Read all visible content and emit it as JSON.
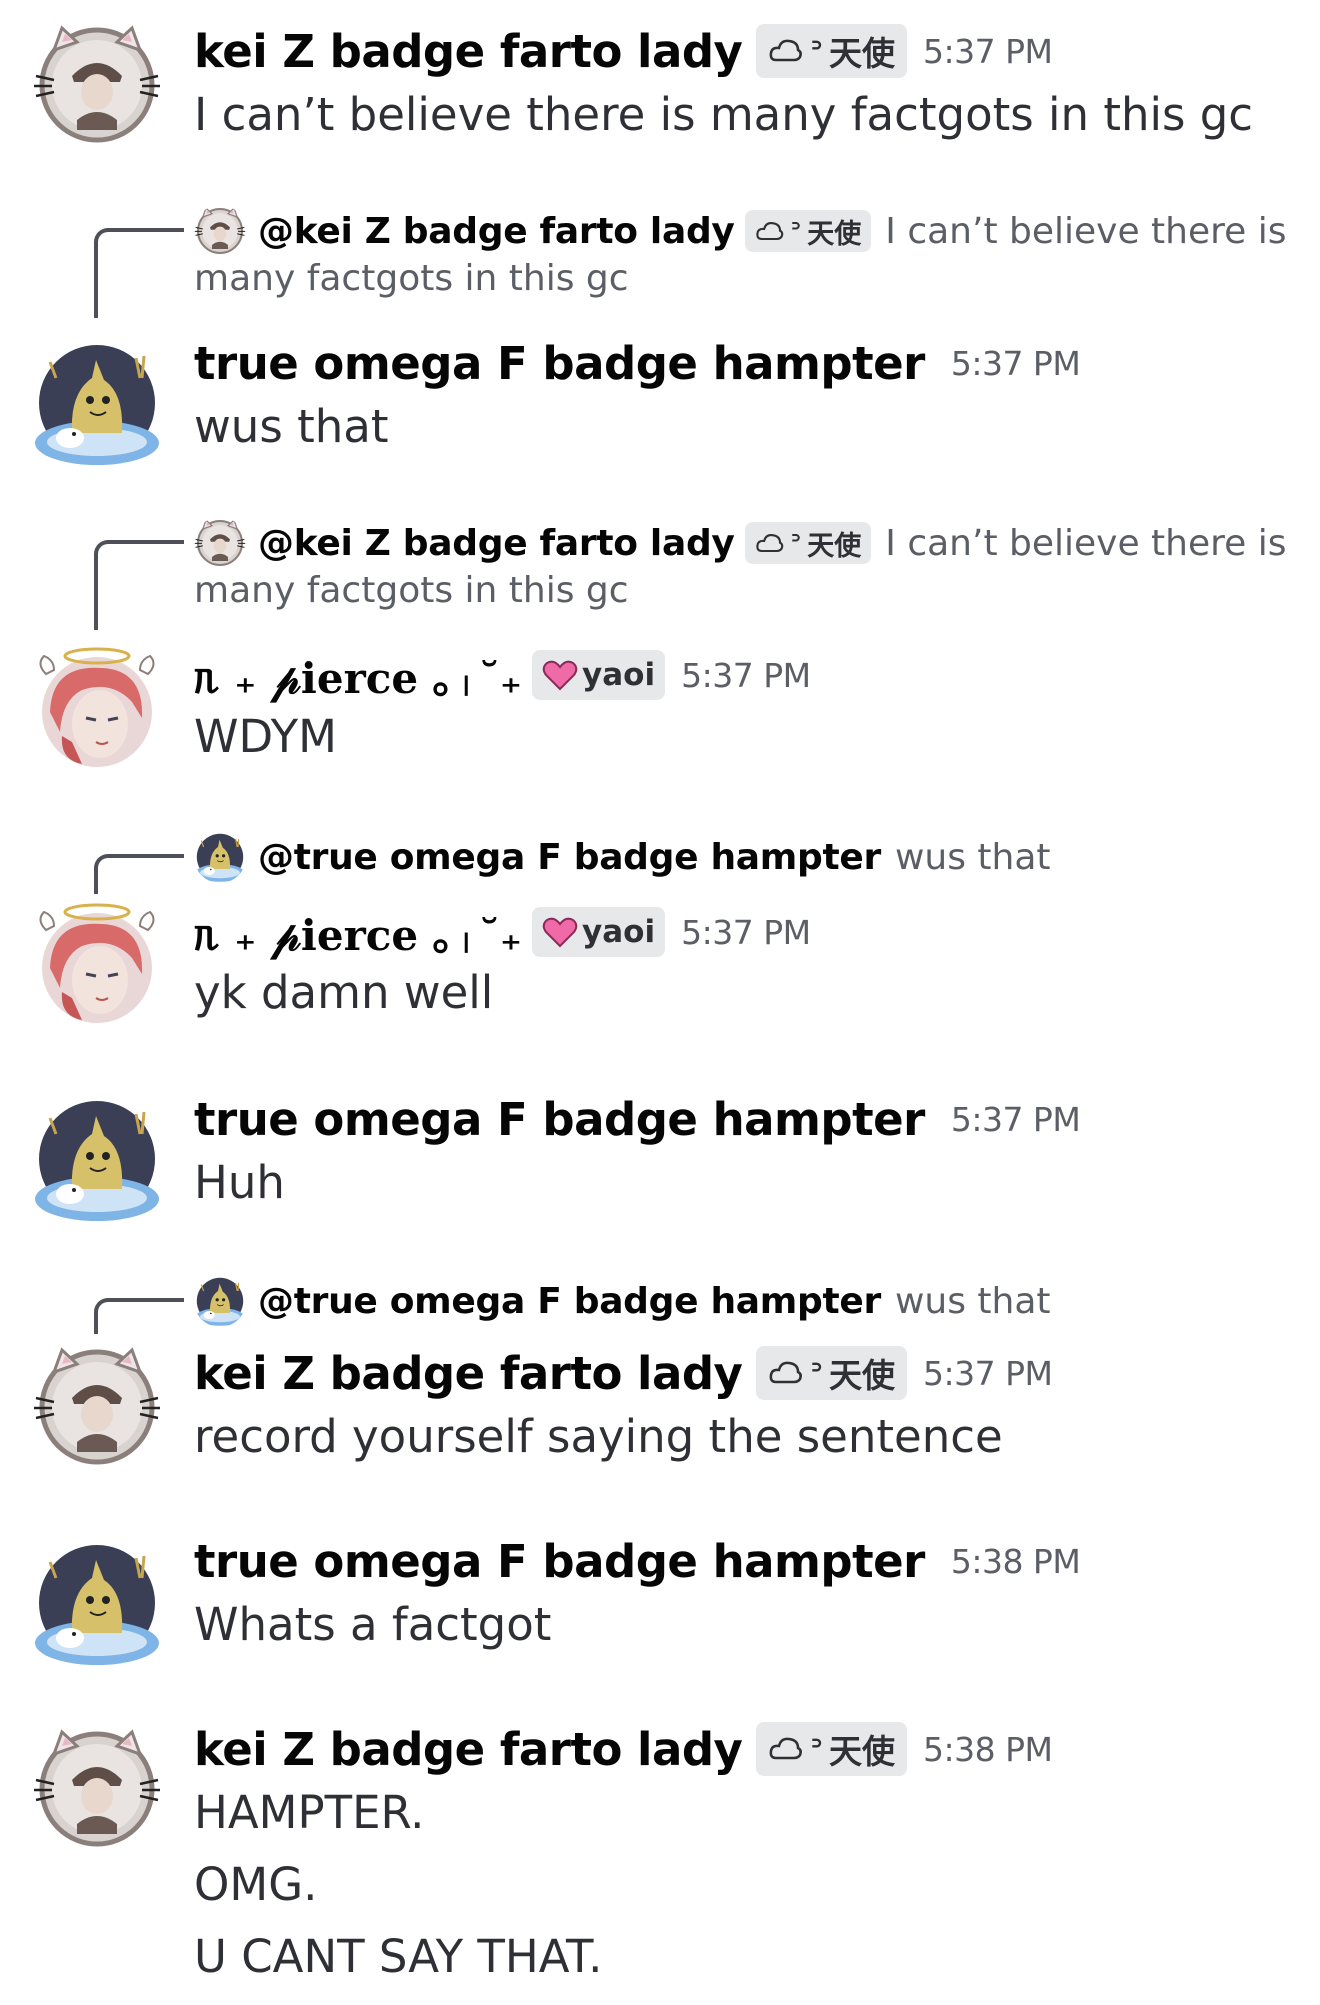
{
  "users": {
    "kei": {
      "name": "kei Z badge farto lady",
      "tag_symbol": "ᐣ",
      "tag_text": "天使"
    },
    "hampter": {
      "name": "true omega F badge hampter"
    },
    "pierce": {
      "name": "ᥰ ₊ 𝓅ierce ｡ᛧ˘₊",
      "tag_text": "yaoi"
    }
  },
  "messages": [
    {
      "author": "kei Z badge farto lady",
      "tag_text": "天使",
      "time": "5:37 PM",
      "lines": [
        "I can’t believe there is many factgots in this gc"
      ]
    },
    {
      "reply": {
        "mention": "@kei Z badge farto lady",
        "tag_text": "天使",
        "text_a": "I can’t believe there is",
        "text_b": "many factgots in this gc"
      },
      "author": "true omega F badge hampter",
      "time": "5:37 PM",
      "lines": [
        "wus that"
      ]
    },
    {
      "reply": {
        "mention": "@kei Z badge farto lady",
        "tag_text": "天使",
        "text_a": "I can’t believe there is",
        "text_b": "many factgots in this gc"
      },
      "author": "ᥰ ₊ 𝓅ierce ｡ᛧ˘₊",
      "tag_text": "yaoi",
      "time": "5:37 PM",
      "lines": [
        "WDYM"
      ]
    },
    {
      "reply": {
        "mention": "@true omega F badge hampter",
        "text_a": "wus that"
      },
      "author": "ᥰ ₊ 𝓅ierce ｡ᛧ˘₊",
      "tag_text": "yaoi",
      "time": "5:37 PM",
      "lines": [
        "yk damn well"
      ]
    },
    {
      "author": "true omega F badge hampter",
      "time": "5:37 PM",
      "lines": [
        "Huh"
      ]
    },
    {
      "reply": {
        "mention": "@true omega F badge hampter",
        "text_a": "wus that"
      },
      "author": "kei Z badge farto lady",
      "tag_text": "天使",
      "time": "5:37 PM",
      "lines": [
        "record yourself saying the sentence"
      ]
    },
    {
      "author": "true omega F badge hampter",
      "time": "5:38 PM",
      "lines": [
        "Whats a factgot"
      ]
    },
    {
      "author": "kei Z badge farto lady",
      "tag_text": "天使",
      "time": "5:38 PM",
      "lines": [
        "HAMPTER.",
        "OMG.",
        "U CANT SAY THAT."
      ]
    }
  ],
  "icons": {
    "kei_avatar": "cat-ear-frame-avatar-icon",
    "hampter_avatar": "mimikyu-pond-avatar-icon",
    "pierce_avatar": "red-hair-halo-avatar-icon",
    "tag_icon": "cloud-outline-icon",
    "yaoi_icon": "pink-heart-icon"
  },
  "colors": {
    "text_primary": "#060607",
    "text_muted": "#5c5e66",
    "tag_bg": "#e7e8ea",
    "heart": "#f06aa8"
  }
}
